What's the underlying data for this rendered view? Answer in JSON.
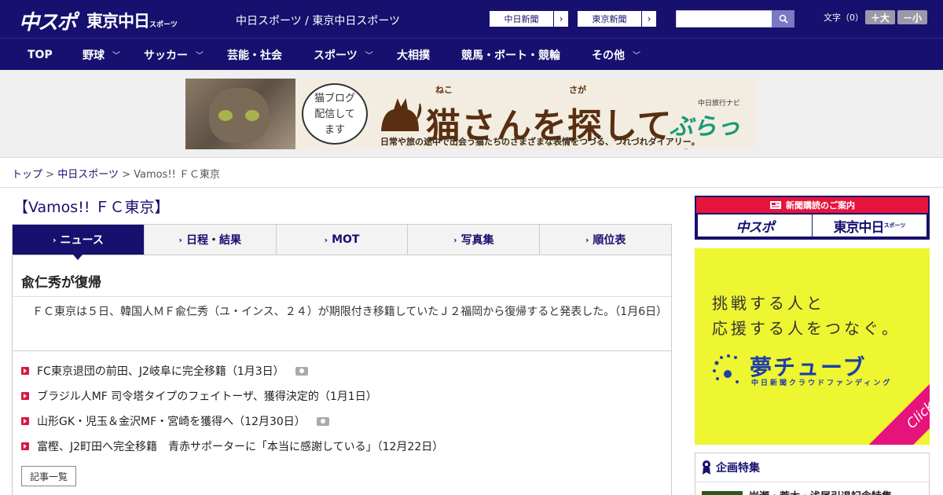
{
  "header": {
    "logo_chuspo": "中スポ",
    "logo_tokyo": "東京中日",
    "logo_tokyo_suffix": "スポーツ",
    "site_names": "中日スポーツ / 東京中日スポーツ",
    "paper_links": [
      {
        "label": "中日新聞"
      },
      {
        "label": "東京新聞"
      }
    ],
    "search": {
      "placeholder": "",
      "value": ""
    },
    "font_size": {
      "label": "文字（0）",
      "larger": "＋大",
      "smaller": "－小"
    }
  },
  "nav": {
    "items": [
      {
        "label": "TOP",
        "has_menu": false
      },
      {
        "label": "野球",
        "has_menu": true
      },
      {
        "label": "サッカー",
        "has_menu": true
      },
      {
        "label": "芸能・社会",
        "has_menu": false
      },
      {
        "label": "スポーツ",
        "has_menu": true
      },
      {
        "label": "大相撲",
        "has_menu": false
      },
      {
        "label": "競馬・ボート・競輪",
        "has_menu": false
      },
      {
        "label": "その他",
        "has_menu": true
      }
    ]
  },
  "banner": {
    "bubble_lines": [
      "猫ブログ",
      "配信して",
      "ます"
    ],
    "ruby_neko": "ねこ",
    "ruby_saga": "さが",
    "title": "猫さんを探して",
    "subtitle": "日常や旅の途中で出会う猫たちのさまざまな表情をつづる、つれづれダイアリー。",
    "brand_small": "中日旅行ナビ",
    "brand": "ぶらっ人"
  },
  "breadcrumb": {
    "top": "トップ",
    "section": "中日スポーツ",
    "sep": " > ",
    "current": "Vamos!! ＦＣ東京"
  },
  "main": {
    "page_title": "【Vamos!! ＦＣ東京】",
    "tabs": [
      {
        "label": "ニュース",
        "active": true
      },
      {
        "label": "日程・結果",
        "active": false
      },
      {
        "label": "MOT",
        "active": false
      },
      {
        "label": "写真集",
        "active": false
      },
      {
        "label": "順位表",
        "active": false
      }
    ],
    "article": {
      "headline": "兪仁秀が復帰",
      "body": "ＦＣ東京は５日、韓国人ＭＦ兪仁秀（ユ・インス、２４）が期限付き移籍していたＪ２福岡から復帰すると発表した。（1月6日）"
    },
    "related": [
      {
        "title": "FC東京退団の前田、J2岐阜に完全移籍（1月3日）",
        "photo": true
      },
      {
        "title": "ブラジル人MF 司令塔タイプのフェイトーザ、獲得決定的（1月1日）",
        "photo": false
      },
      {
        "title": "山形GK・児玉＆金沢MF・宮崎を獲得へ（12月30日）",
        "photo": true
      },
      {
        "title": "富樫、J2町田へ完全移籍　青赤サポーターに「本当に感謝している」（12月22日）",
        "photo": false
      }
    ],
    "more_label": "記事一覧"
  },
  "sidebar": {
    "subscription": {
      "header": "新聞購読のご案内",
      "logo_a": "中スポ",
      "logo_b": "東京中日",
      "logo_b_suffix": "スポーツ"
    },
    "ad": {
      "line1": "挑戦する人と",
      "line2": "応援する人をつなぐ。",
      "logo": "夢チューブ",
      "sub": "中日新聞クラウドファンディング",
      "click": "Click!"
    },
    "feature": {
      "header": "企画特集",
      "item": "岩瀬・荒木・浅尾引退記念特集"
    }
  },
  "colors": {
    "brand_navy": "#17106e",
    "accent_red": "#d8173f",
    "subscription_red": "#e6143c",
    "ad_yellow": "#eef531",
    "ad_pink": "#e6137a"
  }
}
